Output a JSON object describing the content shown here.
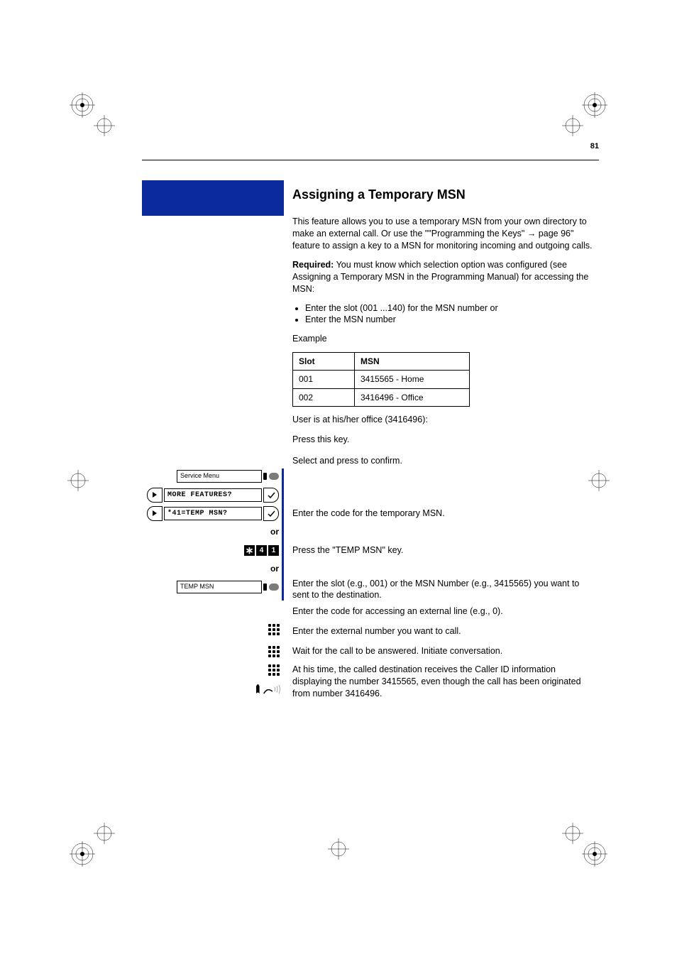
{
  "page_number": "81",
  "section_heading_line1": "Assigning a Temporary MSN",
  "intro_para_a": "This feature allows you to use a temporary MSN from your own directory to make an external call. Or use the \"\"Programming the Keys\" ",
  "intro_arrow": "→",
  "intro_para_b": " page 96\" feature to assign a key to a MSN for monitoring incoming and outgoing calls.",
  "required_label": "Required:",
  "required_text": " You must know which selection option was configured (see Assigning a Temporary MSN in the Programming Manual) for accessing the MSN:",
  "bullets": [
    "Enter the slot (001 ...140) for the MSN number or",
    "Enter the MSN number"
  ],
  "example_label": "Example",
  "table": {
    "headers": [
      "Slot",
      "MSN"
    ],
    "rows": [
      [
        "001",
        "3415565 - Home"
      ],
      [
        "002",
        "3416496 - Office"
      ]
    ]
  },
  "user_office_line": "User is at his/her office (3416496):",
  "left": {
    "service_menu": "Service Menu",
    "more_features": "MORE FEATURES?",
    "temp_msn_code": "*41=TEMP MSN?",
    "or": "or",
    "code_star": "*",
    "code_4": "4",
    "code_1": "1",
    "temp_msn_key": "TEMP MSN"
  },
  "steps": {
    "press_this_key": "Press this key.",
    "select_confirm": "Select and press to confirm.",
    "enter_code_temp": "Enter the code for the temporary MSN.",
    "press_temp_key": "Press the \"TEMP MSN\" key.",
    "enter_slot": "Enter the slot (e.g., 001) or the MSN Number (e.g., 3415565) you want to sent to the destination.",
    "enter_ext_code": "Enter the code for accessing an external line (e.g., 0).",
    "enter_ext_num": "Enter the external number you want to call.",
    "wait_call": "Wait for the call to be answered. Initiate conversation.",
    "caller_id_note": "At his time, the called destination receives the Caller ID information displaying the number 3415565, even though the call has been originated from number 3416496."
  }
}
